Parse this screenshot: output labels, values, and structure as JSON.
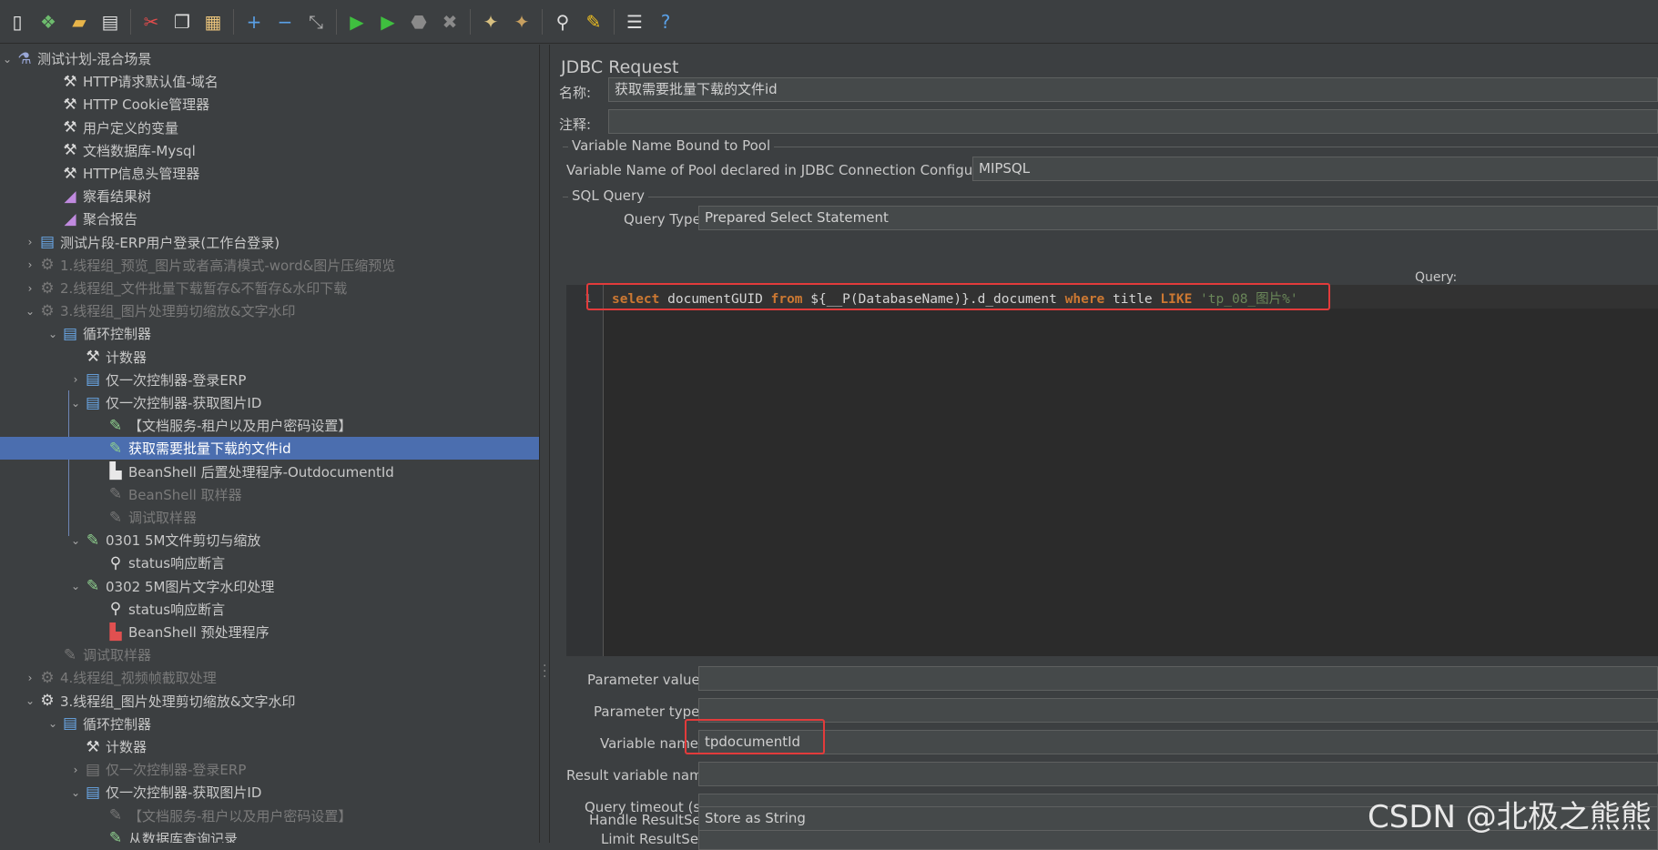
{
  "toolbar": [
    {
      "name": "new-icon",
      "glyph": "▯",
      "color": "#e8e8e8"
    },
    {
      "name": "templates-icon",
      "glyph": "❖",
      "color": "#6dbb6d"
    },
    {
      "name": "open-icon",
      "glyph": "▰",
      "color": "#e8b54a"
    },
    {
      "name": "save-icon",
      "glyph": "▤",
      "color": "#dddddd"
    },
    {
      "sep": true
    },
    {
      "name": "cut-icon",
      "glyph": "✂",
      "color": "#e04c4c"
    },
    {
      "name": "copy-icon",
      "glyph": "❐",
      "color": "#dddddd"
    },
    {
      "name": "paste-icon",
      "glyph": "▦",
      "color": "#e8c27a"
    },
    {
      "sep": true
    },
    {
      "name": "expand-icon",
      "glyph": "+",
      "color": "#5aa0e6"
    },
    {
      "name": "collapse-icon",
      "glyph": "−",
      "color": "#5aa0e6"
    },
    {
      "name": "toggle-icon",
      "glyph": "⤡",
      "color": "#aaaaaa"
    },
    {
      "sep": true
    },
    {
      "name": "start-icon",
      "glyph": "▶",
      "color": "#3fbf3f"
    },
    {
      "name": "start-no-pauses-icon",
      "glyph": "▶",
      "color": "#3fbf3f"
    },
    {
      "name": "stop-icon",
      "glyph": "⬣",
      "color": "#8a8a8a"
    },
    {
      "name": "shutdown-icon",
      "glyph": "✖",
      "color": "#8a8a8a"
    },
    {
      "sep": true
    },
    {
      "name": "remote-start-icon",
      "glyph": "✦",
      "color": "#d8c080"
    },
    {
      "name": "remote-stop-icon",
      "glyph": "✦",
      "color": "#c8a060"
    },
    {
      "sep": true
    },
    {
      "name": "search-icon",
      "glyph": "⚲",
      "color": "#dddddd"
    },
    {
      "name": "clear-icon",
      "glyph": "✎",
      "color": "#f0c020"
    },
    {
      "sep": true
    },
    {
      "name": "function-helper-icon",
      "glyph": "☰",
      "color": "#dddddd"
    },
    {
      "name": "help-icon",
      "glyph": "?",
      "color": "#5aa0e6"
    }
  ],
  "tree": [
    {
      "text": "测试计划-混合场景",
      "indent": 0,
      "arrow": "v",
      "icon": "flask-icon",
      "glyph": "⚗",
      "color": "#9aa8d8"
    },
    {
      "text": "HTTP请求默认值-域名",
      "indent": 2,
      "arrow": "",
      "icon": "config-tools-icon",
      "glyph": "⚒",
      "color": "#d8d8d8"
    },
    {
      "text": "HTTP Cookie管理器",
      "indent": 2,
      "arrow": "",
      "icon": "config-tools-icon",
      "glyph": "⚒",
      "color": "#d8d8d8"
    },
    {
      "text": "用户定义的变量",
      "indent": 2,
      "arrow": "",
      "icon": "config-tools-icon",
      "glyph": "⚒",
      "color": "#d8d8d8"
    },
    {
      "text": "文档数据库-Mysql",
      "indent": 2,
      "arrow": "",
      "icon": "config-tools-icon",
      "glyph": "⚒",
      "color": "#d8d8d8"
    },
    {
      "text": "HTTP信息头管理器",
      "indent": 2,
      "arrow": "",
      "icon": "config-tools-icon",
      "glyph": "⚒",
      "color": "#d8d8d8"
    },
    {
      "text": "察看结果树",
      "indent": 2,
      "arrow": "",
      "icon": "listener-chart-icon",
      "glyph": "◢",
      "color": "#c08adf"
    },
    {
      "text": "聚合报告",
      "indent": 2,
      "arrow": "",
      "icon": "listener-chart-icon",
      "glyph": "◢",
      "color": "#c08adf"
    },
    {
      "text": "测试片段-ERP用户登录(工作台登录)",
      "indent": 1,
      "arrow": ">",
      "icon": "fragment-icon",
      "glyph": "▤",
      "color": "#6aa8e8"
    },
    {
      "text": "1.线程组_预览_图片或者高清模式-word&图片压缩预览",
      "indent": 1,
      "arrow": ">",
      "icon": "thread-group-gear-icon",
      "glyph": "⚙",
      "color": "#777777",
      "disabled": true
    },
    {
      "text": "2.线程组_文件批量下载暂存&不暂存&水印下载",
      "indent": 1,
      "arrow": ">",
      "icon": "thread-group-gear-icon",
      "glyph": "⚙",
      "color": "#777777",
      "disabled": true
    },
    {
      "text": "3.线程组_图片处理剪切缩放&文字水印",
      "indent": 1,
      "arrow": "v",
      "icon": "thread-group-gear-icon",
      "glyph": "⚙",
      "color": "#777777",
      "disabled": true
    },
    {
      "text": "循环控制器",
      "indent": 2,
      "arrow": "v",
      "icon": "controller-icon",
      "glyph": "▤",
      "color": "#6aa8e8"
    },
    {
      "text": "计数器",
      "indent": 3,
      "arrow": "",
      "icon": "config-tools-icon",
      "glyph": "⚒",
      "color": "#d8d8d8"
    },
    {
      "text": "仅一次控制器-登录ERP",
      "indent": 3,
      "arrow": ">",
      "icon": "controller-icon",
      "glyph": "▤",
      "color": "#6aa8e8"
    },
    {
      "text": "仅一次控制器-获取图片ID",
      "indent": 3,
      "arrow": "v",
      "icon": "controller-icon",
      "glyph": "▤",
      "color": "#6aa8e8"
    },
    {
      "text": "【文档服务-租户以及用户密码设置】",
      "indent": 4,
      "arrow": "",
      "icon": "sampler-pipette-icon",
      "glyph": "✎",
      "color": "#8fd08f"
    },
    {
      "text": "获取需要批量下载的文件id",
      "indent": 4,
      "arrow": "",
      "icon": "sampler-pipette-icon",
      "glyph": "✎",
      "color": "#8fd08f",
      "selected": true
    },
    {
      "text": "BeanShell 后置处理程序-OutdocumentId",
      "indent": 4,
      "arrow": "",
      "icon": "post-processor-icon",
      "glyph": "▙",
      "color": "#e8e8e8"
    },
    {
      "text": "BeanShell 取样器",
      "indent": 4,
      "arrow": "",
      "icon": "sampler-pipette-icon",
      "glyph": "✎",
      "color": "#777777",
      "disabled": true
    },
    {
      "text": "调试取样器",
      "indent": 4,
      "arrow": "",
      "icon": "sampler-pipette-icon",
      "glyph": "✎",
      "color": "#777777",
      "disabled": true
    },
    {
      "text": "0301 5M文件剪切与缩放",
      "indent": 3,
      "arrow": "v",
      "icon": "sampler-pipette-icon",
      "glyph": "✎",
      "color": "#8fd08f"
    },
    {
      "text": "status响应断言",
      "indent": 4,
      "arrow": "",
      "icon": "assertion-magnifier-icon",
      "glyph": "⚲",
      "color": "#dddddd"
    },
    {
      "text": "0302 5M图片文字水印处理",
      "indent": 3,
      "arrow": "v",
      "icon": "sampler-pipette-icon",
      "glyph": "✎",
      "color": "#8fd08f"
    },
    {
      "text": "status响应断言",
      "indent": 4,
      "arrow": "",
      "icon": "assertion-magnifier-icon",
      "glyph": "⚲",
      "color": "#dddddd"
    },
    {
      "text": "BeanShell 预处理程序",
      "indent": 4,
      "arrow": "",
      "icon": "pre-processor-icon",
      "glyph": "▙",
      "color": "#e05050"
    },
    {
      "text": "调试取样器",
      "indent": 2,
      "arrow": "",
      "icon": "sampler-pipette-icon",
      "glyph": "✎",
      "color": "#777777",
      "disabled": true
    },
    {
      "text": "4.线程组_视频帧截取处理",
      "indent": 1,
      "arrow": ">",
      "icon": "thread-group-gear-icon",
      "glyph": "⚙",
      "color": "#777777",
      "disabled": true
    },
    {
      "text": "3.线程组_图片处理剪切缩放&文字水印",
      "indent": 1,
      "arrow": "v",
      "icon": "thread-group-gear-icon",
      "glyph": "⚙",
      "color": "#d8d8d8"
    },
    {
      "text": "循环控制器",
      "indent": 2,
      "arrow": "v",
      "icon": "controller-icon",
      "glyph": "▤",
      "color": "#6aa8e8"
    },
    {
      "text": "计数器",
      "indent": 3,
      "arrow": "",
      "icon": "config-tools-icon",
      "glyph": "⚒",
      "color": "#d8d8d8"
    },
    {
      "text": "仅一次控制器-登录ERP",
      "indent": 3,
      "arrow": ">",
      "icon": "controller-icon",
      "glyph": "▤",
      "color": "#777777",
      "disabled": true
    },
    {
      "text": "仅一次控制器-获取图片ID",
      "indent": 3,
      "arrow": "v",
      "icon": "controller-icon",
      "glyph": "▤",
      "color": "#6aa8e8"
    },
    {
      "text": "【文档服务-租户以及用户密码设置】",
      "indent": 4,
      "arrow": "",
      "icon": "sampler-pipette-icon",
      "glyph": "✎",
      "color": "#777777",
      "disabled": true
    },
    {
      "text": "从数据库查询记录",
      "indent": 4,
      "arrow": "",
      "icon": "sampler-pipette-icon",
      "glyph": "✎",
      "color": "#8fd08f"
    }
  ],
  "panel": {
    "title": "JDBC Request",
    "name_label": "名称:",
    "name_value": "获取需要批量下载的文件id",
    "comment_label": "注释:",
    "comment_value": "",
    "pool_section": "Variable Name Bound to Pool",
    "pool_label": "Variable Name of Pool declared in JDBC Connection Configuration:",
    "pool_value": "MIPSQL",
    "sql_section": "SQL Query",
    "query_type_label": "Query Type:",
    "query_type_value": "Prepared Select Statement",
    "query_label": "Query:",
    "line_number": "1",
    "query_tokens": [
      {
        "t": "select",
        "k": "kw"
      },
      {
        "t": " documentGUID ",
        "k": ""
      },
      {
        "t": "from",
        "k": "kw"
      },
      {
        "t": " ${__P(DatabaseName)}.d_document ",
        "k": ""
      },
      {
        "t": "where",
        "k": "kw"
      },
      {
        "t": " title ",
        "k": ""
      },
      {
        "t": "LIKE",
        "k": "kw"
      },
      {
        "t": " 'tp_08_图片%'",
        "k": "str"
      }
    ],
    "param_values_label": "Parameter values:",
    "param_values": "",
    "param_types_label": "Parameter types:",
    "param_types": "",
    "var_names_label": "Variable names:",
    "var_names": "tpdocumentId",
    "result_var_label": "Result variable name:",
    "result_var": "",
    "timeout_label": "Query timeout (s):",
    "timeout": "",
    "limit_label": "Limit ResultSet:",
    "limit": "",
    "handle_label": "Handle ResultSet:",
    "handle": "Store as String"
  },
  "watermark": "CSDN @北极之熊熊",
  "colors": {
    "highlight_box": "#e23b3b",
    "selection": "#4b6eaf",
    "background": "#3c3f41",
    "editor": "#2b2b2b"
  }
}
